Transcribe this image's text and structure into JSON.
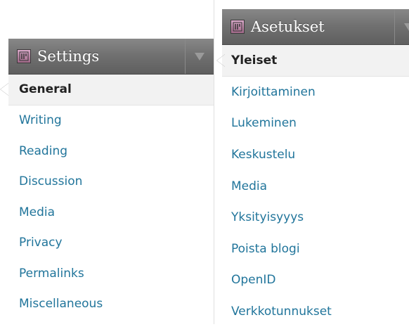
{
  "left_menu": {
    "title": "Settings",
    "icon": "settings-icon",
    "items": [
      "General",
      "Writing",
      "Reading",
      "Discussion",
      "Media",
      "Privacy",
      "Permalinks",
      "Miscellaneous"
    ],
    "current": "General"
  },
  "right_menu": {
    "title": "Asetukset",
    "icon": "settings-icon",
    "items": [
      "Yleiset",
      "Kirjoittaminen",
      "Lukeminen",
      "Keskustelu",
      "Media",
      "Yksityisyyys",
      "Poista blogi",
      "OpenID",
      "Verkkotunnukset"
    ],
    "current": "Yleiset"
  },
  "colors": {
    "link": "#21759b",
    "current_text": "#222222",
    "header_bg": "#717171"
  }
}
